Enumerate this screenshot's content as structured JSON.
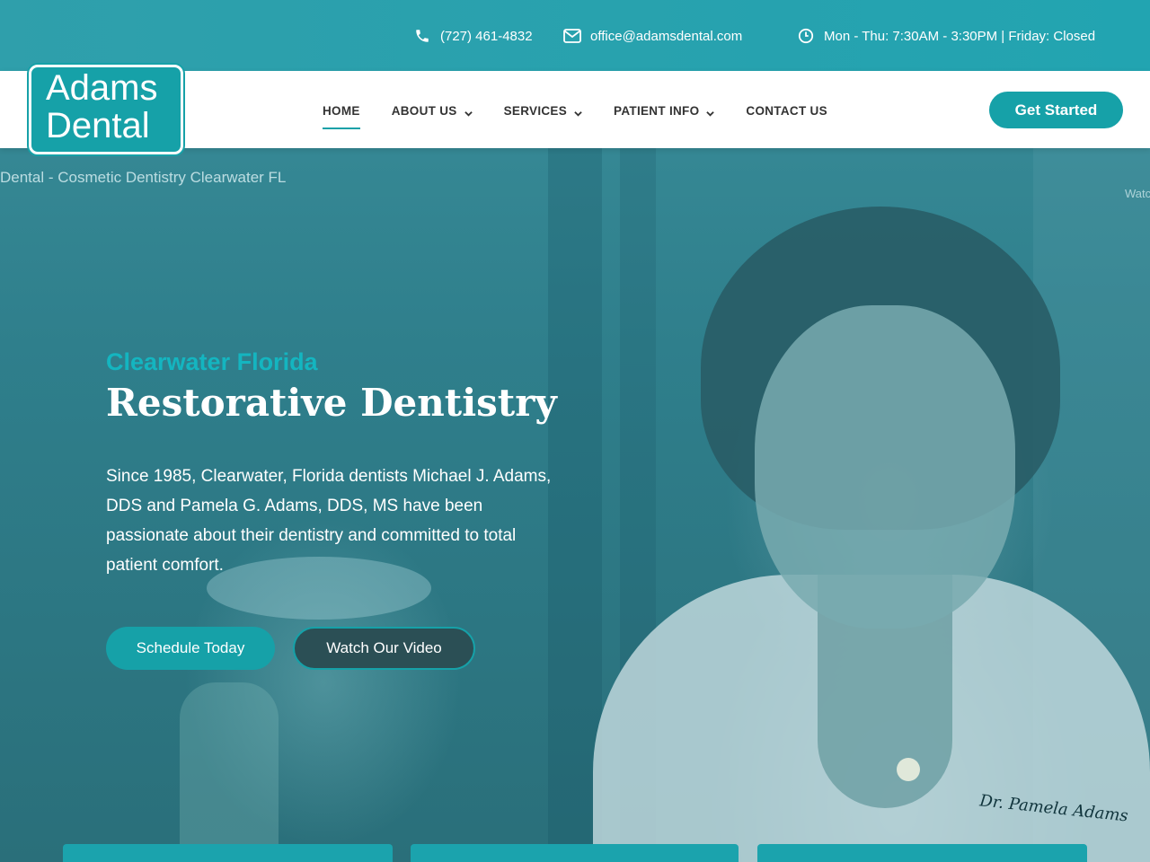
{
  "topbar": {
    "phone": "(727) 461-4832",
    "email": "office@adamsdental.com",
    "hours": "Mon - Thu: 7:30AM - 3:30PM | Friday: Closed",
    "icons": {
      "phone": "phone-icon",
      "email": "envelope-icon",
      "hours": "clock-icon"
    }
  },
  "logo": {
    "line1": "Adams",
    "line2": "Dental"
  },
  "nav": [
    {
      "label": "HOME",
      "active": true,
      "dropdown": false
    },
    {
      "label": "ABOUT US",
      "active": false,
      "dropdown": true
    },
    {
      "label": "SERVICES",
      "active": false,
      "dropdown": true
    },
    {
      "label": "PATIENT INFO",
      "active": false,
      "dropdown": true
    },
    {
      "label": "CONTACT US",
      "active": false,
      "dropdown": false
    }
  ],
  "header": {
    "cta_label": "Get Started"
  },
  "video": {
    "title": "Dental - Cosmetic Dentistry Clearwater FL",
    "watch_label": "Watc"
  },
  "hero": {
    "eyebrow": "Clearwater Florida",
    "headline": "Restorative Dentistry",
    "lead": "Since 1985, Clearwater, Florida dentists Michael J. Adams, DDS and Pamela G. Adams, DDS, MS have been passionate about their dentistry and committed to total patient comfort.",
    "primary_button": "Schedule Today",
    "secondary_button": "Watch Our Video",
    "signature_text": "Dr. Pamela Adams"
  },
  "colors": {
    "accent": "#16a1a8",
    "topbar": "#22a4b1",
    "eyebrow": "#14b5c0"
  }
}
